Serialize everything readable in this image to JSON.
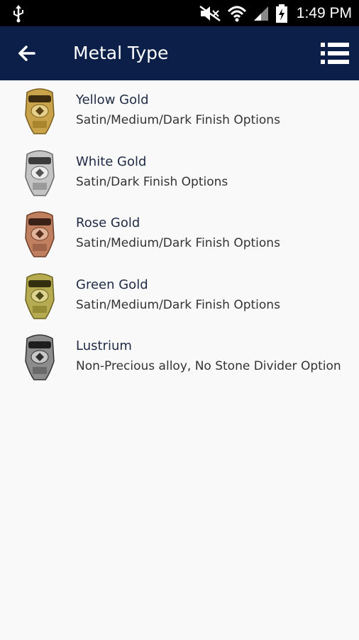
{
  "status_bar": {
    "time": "1:49 PM",
    "icons": [
      "usb-icon",
      "mute-icon",
      "wifi-icon",
      "signal-icon",
      "battery-icon"
    ]
  },
  "app_bar": {
    "title": "Metal Type",
    "back_icon": "arrow-left-icon",
    "menu_icon": "list-view-icon",
    "background": "#0b1f48"
  },
  "metals": [
    {
      "name": "Yellow Gold",
      "description": "Satin/Medium/Dark Finish Options",
      "ring_icon": "yellow-gold-ring-icon",
      "color": "#c9a34a"
    },
    {
      "name": "White Gold",
      "description": "Satin/Dark Finish Options",
      "ring_icon": "white-gold-ring-icon",
      "color": "#b8b8b8"
    },
    {
      "name": "Rose Gold",
      "description": "Satin/Medium/Dark Finish Options",
      "ring_icon": "rose-gold-ring-icon",
      "color": "#c08060"
    },
    {
      "name": "Green Gold",
      "description": "Satin/Medium/Dark Finish Options",
      "ring_icon": "green-gold-ring-icon",
      "color": "#b7ab52"
    },
    {
      "name": "Lustrium",
      "description": "Non-Precious alloy, No Stone Divider Option",
      "ring_icon": "lustrium-ring-icon",
      "color": "#8c8c8c"
    }
  ]
}
